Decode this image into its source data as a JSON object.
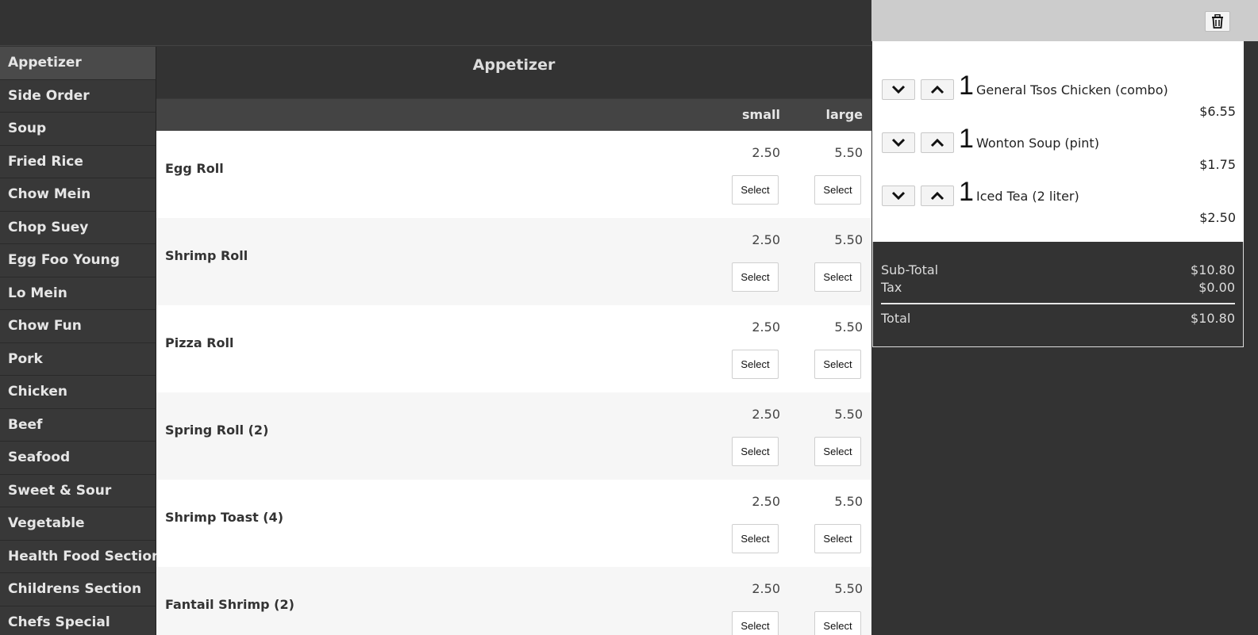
{
  "categories": [
    {
      "label": "Appetizer",
      "active": true
    },
    {
      "label": "Side Order"
    },
    {
      "label": "Soup"
    },
    {
      "label": "Fried Rice"
    },
    {
      "label": "Chow Mein"
    },
    {
      "label": "Chop Suey"
    },
    {
      "label": "Egg Foo Young"
    },
    {
      "label": "Lo Mein"
    },
    {
      "label": "Chow Fun"
    },
    {
      "label": "Pork"
    },
    {
      "label": "Chicken"
    },
    {
      "label": "Beef"
    },
    {
      "label": "Seafood"
    },
    {
      "label": "Sweet & Sour"
    },
    {
      "label": "Vegetable"
    },
    {
      "label": "Health Food Section"
    },
    {
      "label": "Childrens Section"
    },
    {
      "label": "Chefs Special"
    }
  ],
  "main": {
    "title": "Appetizer",
    "size_small": "small",
    "size_large": "large",
    "select_label": "Select",
    "items": [
      {
        "name": "Egg Roll",
        "small": "2.50",
        "large": "5.50"
      },
      {
        "name": "Shrimp Roll",
        "small": "2.50",
        "large": "5.50"
      },
      {
        "name": "Pizza Roll",
        "small": "2.50",
        "large": "5.50"
      },
      {
        "name": "Spring Roll (2)",
        "small": "2.50",
        "large": "5.50"
      },
      {
        "name": "Shrimp Toast (4)",
        "small": "2.50",
        "large": "5.50"
      },
      {
        "name": "Fantail Shrimp (2)",
        "small": "2.50",
        "large": "5.50"
      }
    ]
  },
  "order": {
    "icons": {
      "clear": "trash-icon",
      "decrease": "chevron-down-icon",
      "increase": "chevron-up-icon"
    },
    "lines": [
      {
        "qty": "1",
        "name": "General Tsos Chicken (combo)",
        "price": "$6.55"
      },
      {
        "qty": "1",
        "name": "Wonton Soup (pint)",
        "price": "$1.75"
      },
      {
        "qty": "1",
        "name": "Iced Tea (2 liter)",
        "price": "$2.50"
      }
    ],
    "subtotal_label": "Sub-Total",
    "subtotal": "$10.80",
    "tax_label": "Tax",
    "tax": "$0.00",
    "total_label": "Total",
    "total": "$10.80"
  },
  "colors": {
    "background": "#333333",
    "sidebar_item": "#383838",
    "sidebar_active": "#4a4a4a",
    "header_bar": "#444444",
    "order_header": "#cccccc"
  }
}
